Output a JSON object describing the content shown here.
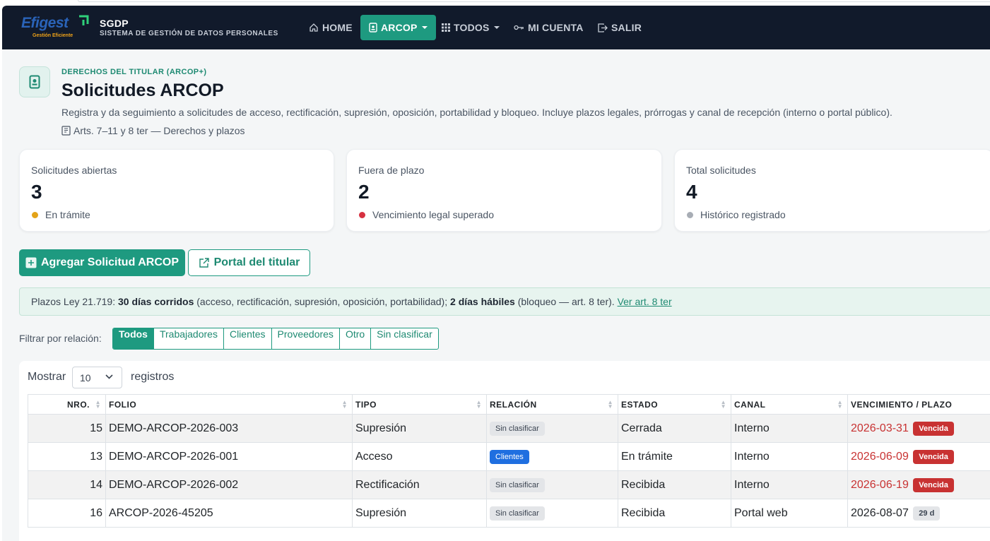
{
  "nav": {
    "brand_word": "Efigest",
    "brand_tag": "Gestión Eficiente",
    "app_title": "SGDP",
    "app_subtitle": "SISTEMA DE GESTIÓN DE DATOS PERSONALES",
    "items": [
      {
        "label": "HOME"
      },
      {
        "label": "ARCOP"
      },
      {
        "label": "TODOS"
      },
      {
        "label": "MI CUENTA"
      },
      {
        "label": "SALIR"
      }
    ]
  },
  "header": {
    "eyebrow": "DERECHOS DEL TITULAR (ARCOP+)",
    "title": "Solicitudes ARCOP",
    "description": "Registra y da seguimiento a solicitudes de acceso, rectificación, supresión, oposición, portabilidad y bloqueo. Incluye plazos legales, prórrogas y canal de recepción (interno o portal público).",
    "reference": "Arts. 7–11 y 8 ter — Derechos y plazos"
  },
  "stats": [
    {
      "label": "Solicitudes abiertas",
      "value": "3",
      "foot": "En trámite",
      "color": "#e3a319"
    },
    {
      "label": "Fuera de plazo",
      "value": "2",
      "foot": "Vencimiento legal superado",
      "color": "#d63040"
    },
    {
      "label": "Total solicitudes",
      "value": "4",
      "foot": "Histórico registrado",
      "color": "#a8adb5"
    }
  ],
  "actions": {
    "add_label": "Agregar Solicitud ARCOP",
    "portal_label": "Portal del titular"
  },
  "info": {
    "prefix": "Plazos Ley 21.719: ",
    "bold1": "30 días corridos",
    "mid": " (acceso, rectificación, supresión, oposición, portabilidad); ",
    "bold2": "2 días hábiles",
    "suffix": " (bloqueo — art. 8 ter). ",
    "link": "Ver art. 8 ter"
  },
  "filter": {
    "label": "Filtrar por relación:",
    "options": [
      "Todos",
      "Trabajadores",
      "Clientes",
      "Proveedores",
      "Otro",
      "Sin clasificar"
    ]
  },
  "table": {
    "show_label": "Mostrar",
    "page_size": "10",
    "records_label": "registros",
    "columns": [
      "NRO.",
      "FOLIO",
      "TIPO",
      "RELACIÓN",
      "ESTADO",
      "CANAL",
      "VENCIMIENTO / PLAZO"
    ],
    "rows": [
      {
        "nro": "15",
        "folio": "DEMO-ARCOP-2026-003",
        "tipo": "Supresión",
        "relacion": "Sin clasificar",
        "estado": "Cerrada",
        "canal": "Interno",
        "venc": "2026-03-31",
        "plazo": "Vencida"
      },
      {
        "nro": "13",
        "folio": "DEMO-ARCOP-2026-001",
        "tipo": "Acceso",
        "relacion": "Clientes",
        "estado": "En trámite",
        "canal": "Interno",
        "venc": "2026-06-09",
        "plazo": "Vencida"
      },
      {
        "nro": "14",
        "folio": "DEMO-ARCOP-2026-002",
        "tipo": "Rectificación",
        "relacion": "Sin clasificar",
        "estado": "Recibida",
        "canal": "Interno",
        "venc": "2026-06-19",
        "plazo": "Vencida"
      },
      {
        "nro": "16",
        "folio": "ARCOP-2026-45205",
        "tipo": "Supresión",
        "relacion": "Sin clasificar",
        "estado": "Recibida",
        "canal": "Portal web",
        "venc": "2026-08-07",
        "plazo": "29 d"
      }
    ]
  },
  "colors": {
    "accent": "#1e9a80",
    "navbar": "#111a2b",
    "danger": "#c83232",
    "badge_blue": "#1f6fe0"
  }
}
